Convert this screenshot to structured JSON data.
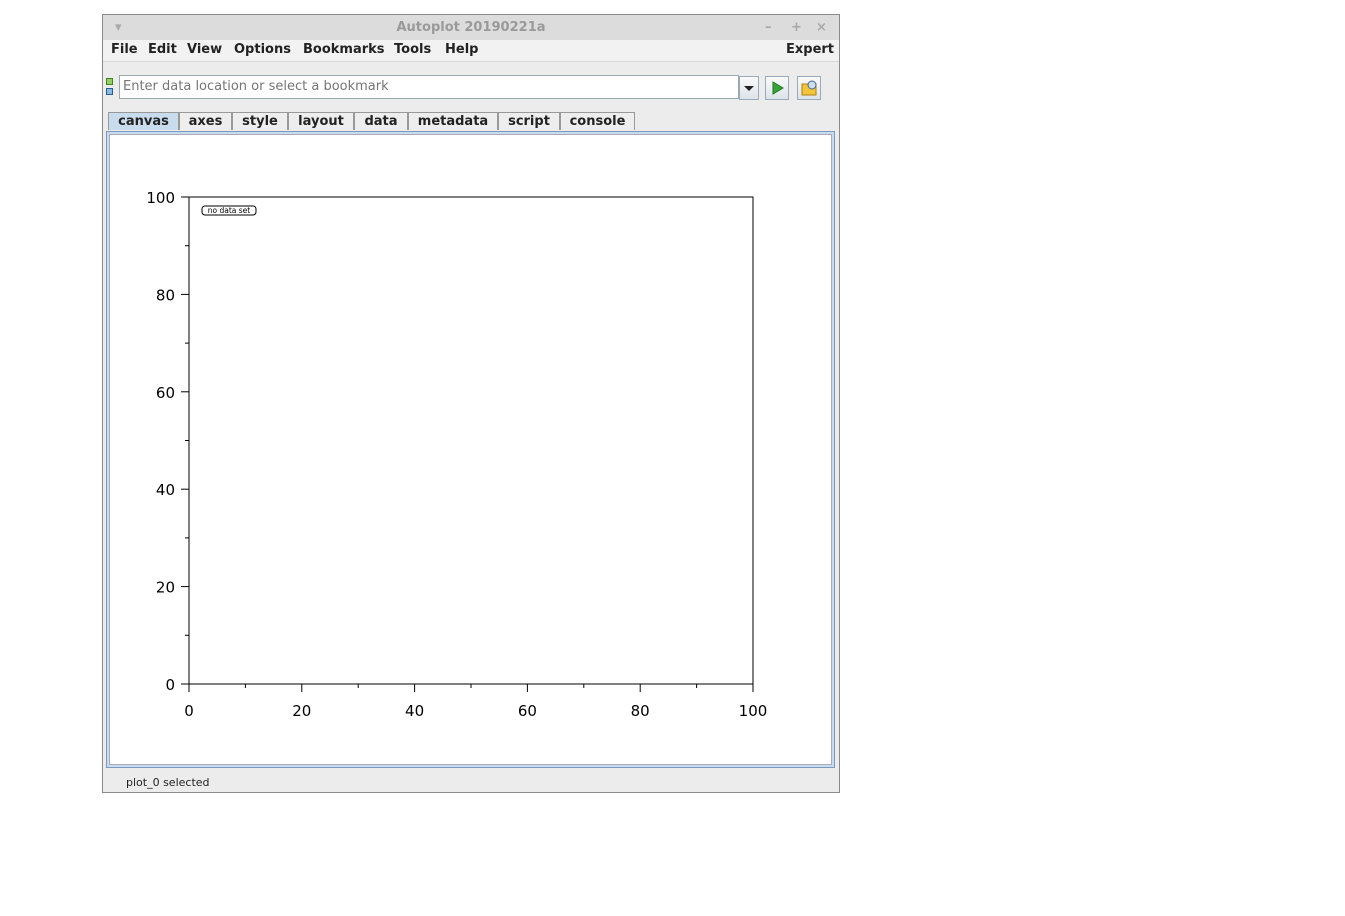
{
  "window": {
    "title": "Autoplot 20190221a",
    "minimize": "–",
    "maximize": "+",
    "close": "×",
    "menu_glyph": "▾"
  },
  "menu": {
    "items": [
      "File",
      "Edit",
      "View",
      "Options",
      "Bookmarks",
      "Tools",
      "Help"
    ],
    "expert": "Expert"
  },
  "address": {
    "placeholder": "Enter data location or select a bookmark",
    "value": ""
  },
  "tabs": [
    "canvas",
    "axes",
    "style",
    "layout",
    "data",
    "metadata",
    "script",
    "console"
  ],
  "active_tab": "canvas",
  "status": "plot_0 selected",
  "chart_data": {
    "type": "line",
    "series": [],
    "annotation": "no data set",
    "xlim": [
      0,
      100
    ],
    "ylim": [
      0,
      100
    ],
    "xticks": [
      "0",
      "20",
      "40",
      "60",
      "80",
      "100"
    ],
    "yticks": [
      "0",
      "20",
      "40",
      "60",
      "80",
      "100"
    ],
    "xlabel": "",
    "ylabel": "",
    "title": "",
    "grid": false
  }
}
